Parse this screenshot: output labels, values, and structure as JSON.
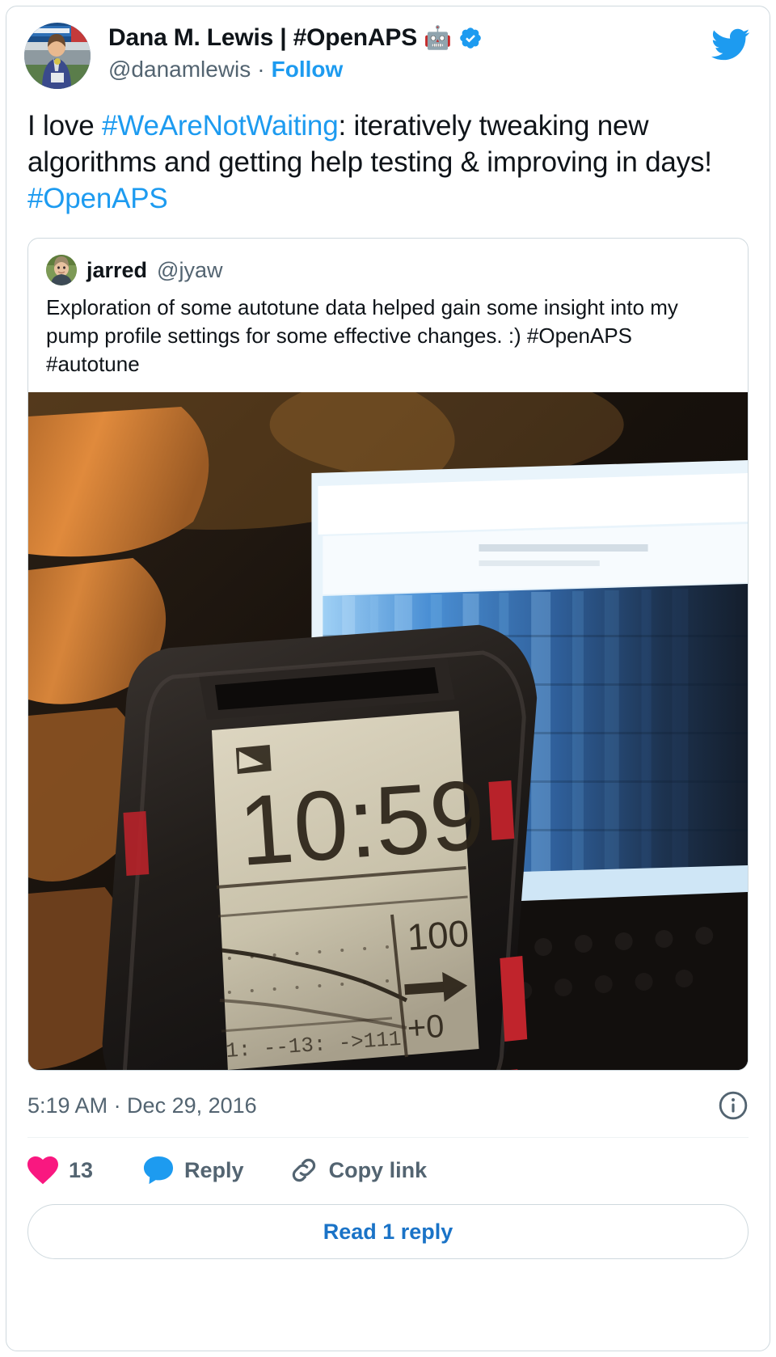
{
  "card": {
    "border_color": "#cfd9de",
    "background": "#ffffff"
  },
  "colors": {
    "link_blue": "#1d9bf0",
    "read_reply_blue": "#1a73c7",
    "text_primary": "#0f1419",
    "text_secondary": "#536471",
    "like_pink": "#f91880",
    "reply_blue": "#1d9bf0",
    "verified_blue": "#1d9bf0"
  },
  "header": {
    "avatar_alt": "Dana M. Lewis profile photo",
    "display_name": "Dana M. Lewis | #OpenAPS",
    "robot_emoji": "🤖",
    "verified_icon": "verified-badge-icon",
    "handle": "@danamlewis",
    "separator": "·",
    "follow_label": "Follow",
    "brand_icon": "twitter-bird-icon"
  },
  "tweet": {
    "text_parts": [
      {
        "type": "text",
        "value": "I love "
      },
      {
        "type": "hashtag",
        "value": "#WeAreNotWaiting"
      },
      {
        "type": "text",
        "value": ": iteratively tweaking new algorithms and getting help testing & improving in days! "
      },
      {
        "type": "hashtag",
        "value": "#OpenAPS"
      }
    ],
    "full_text": "I love #WeAreNotWaiting: iteratively tweaking new algorithms and getting help testing & improving in days! #OpenAPS"
  },
  "quoted_tweet": {
    "avatar_alt": "jarred profile photo",
    "display_name": "jarred",
    "handle": "@jyaw",
    "body": "Exploration of some autotune data helped gain some insight into my pump profile settings for some effective changes. :) #OpenAPS #autotune",
    "media": {
      "alt": "Close-up photo of a black Pebble smartwatch held in fingers, displaying the time and blood glucose data, with a laptop screen showing blue graphs in the background",
      "watch_time": "10:59",
      "watch_bg_value": "100",
      "watch_trend_arrow": "→",
      "watch_delta": "+0",
      "watch_status_line": "1: --13: ->111"
    }
  },
  "footer": {
    "timestamp": "5:19 AM · Dec 29, 2016",
    "info_icon": "info-circle-icon"
  },
  "actions": {
    "like": {
      "icon": "heart-icon",
      "count": "13"
    },
    "reply": {
      "icon": "speech-bubble-icon",
      "label": "Reply"
    },
    "copy_link": {
      "icon": "chain-link-icon",
      "label": "Copy link"
    }
  },
  "read_replies": {
    "label": "Read 1 reply"
  }
}
